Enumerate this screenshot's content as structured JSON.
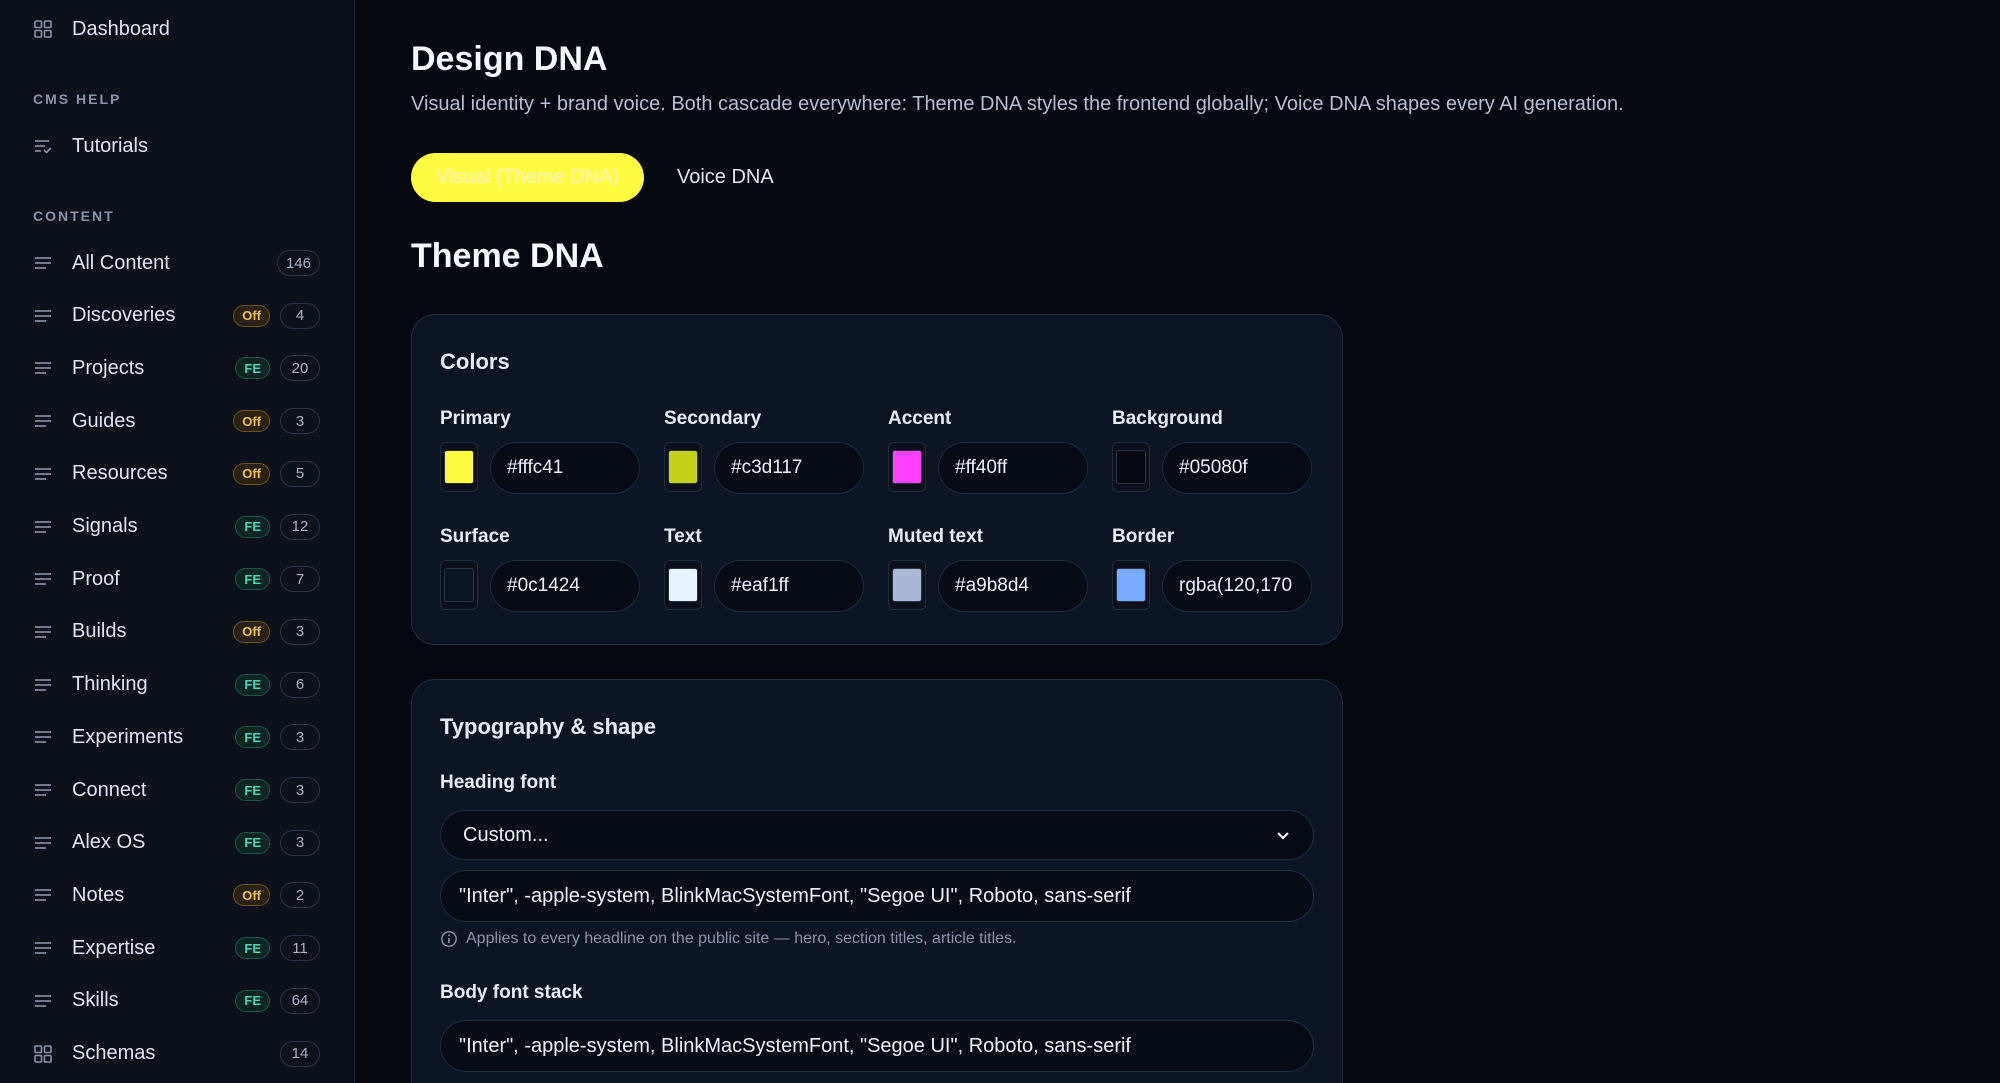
{
  "sidebar": {
    "top_item": {
      "label": "Dashboard",
      "icon": "grid-icon"
    },
    "cms_help_heading": "CMS HELP",
    "tutorials": {
      "label": "Tutorials",
      "icon": "list-check-icon"
    },
    "content_heading": "CONTENT",
    "items": [
      {
        "label": "All Content",
        "badge": "",
        "count": "146"
      },
      {
        "label": "Discoveries",
        "badge": "Off",
        "count": "4"
      },
      {
        "label": "Projects",
        "badge": "FE",
        "count": "20"
      },
      {
        "label": "Guides",
        "badge": "Off",
        "count": "3"
      },
      {
        "label": "Resources",
        "badge": "Off",
        "count": "5"
      },
      {
        "label": "Signals",
        "badge": "FE",
        "count": "12"
      },
      {
        "label": "Proof",
        "badge": "FE",
        "count": "7"
      },
      {
        "label": "Builds",
        "badge": "Off",
        "count": "3"
      },
      {
        "label": "Thinking",
        "badge": "FE",
        "count": "6"
      },
      {
        "label": "Experiments",
        "badge": "FE",
        "count": "3"
      },
      {
        "label": "Connect",
        "badge": "FE",
        "count": "3"
      },
      {
        "label": "Alex OS",
        "badge": "FE",
        "count": "3"
      },
      {
        "label": "Notes",
        "badge": "Off",
        "count": "2"
      },
      {
        "label": "Expertise",
        "badge": "FE",
        "count": "11"
      },
      {
        "label": "Skills",
        "badge": "FE",
        "count": "64"
      },
      {
        "label": "Schemas",
        "badge": "",
        "count": "14"
      }
    ]
  },
  "main": {
    "title": "Design DNA",
    "subtitle": "Visual identity + brand voice. Both cascade everywhere: Theme DNA styles the frontend globally; Voice DNA shapes every AI generation.",
    "tabs": [
      {
        "label": "Visual (Theme DNA)",
        "active": true
      },
      {
        "label": "Voice DNA",
        "active": false
      }
    ],
    "section_title": "Theme DNA",
    "colors_card": {
      "title": "Colors",
      "fields": [
        {
          "label": "Primary",
          "value": "#fffc41",
          "swatch": "#fffc41"
        },
        {
          "label": "Secondary",
          "value": "#c3d117",
          "swatch": "#c3d117"
        },
        {
          "label": "Accent",
          "value": "#ff40ff",
          "swatch": "#ff40ff"
        },
        {
          "label": "Background",
          "value": "#05080f",
          "swatch": "#05080f"
        },
        {
          "label": "Surface",
          "value": "#0c1424",
          "swatch": "#0c1424"
        },
        {
          "label": "Text",
          "value": "#eaf1ff",
          "swatch": "#eaf1ff"
        },
        {
          "label": "Muted text",
          "value": "#a9b8d4",
          "swatch": "#a9b8d4"
        },
        {
          "label": "Border",
          "value": "rgba(120,170",
          "swatch": "#78aaff"
        }
      ]
    },
    "typography_card": {
      "title": "Typography & shape",
      "heading_font_label": "Heading font",
      "heading_font_select": "Custom...",
      "heading_font_value": "\"Inter\", -apple-system, BlinkMacSystemFont, \"Segoe UI\", Roboto, sans-serif",
      "heading_font_hint": "Applies to every headline on the public site — hero, section titles, article titles.",
      "body_font_label": "Body font stack",
      "body_font_value": "\"Inter\", -apple-system, BlinkMacSystemFont, \"Segoe UI\", Roboto, sans-serif"
    }
  }
}
